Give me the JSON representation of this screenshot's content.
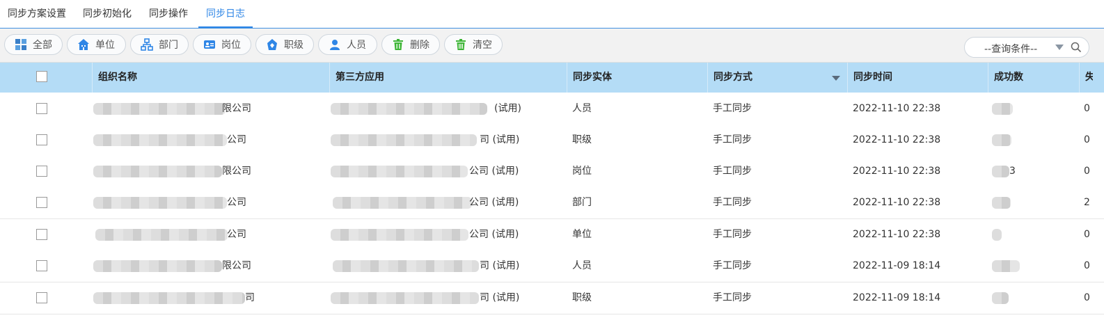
{
  "tabs": [
    {
      "label": "同步方案设置"
    },
    {
      "label": "同步初始化"
    },
    {
      "label": "同步操作"
    },
    {
      "label": "同步日志",
      "active": true
    }
  ],
  "toolbar": {
    "buttons": [
      {
        "label": "全部",
        "icon": "grid-all-icon"
      },
      {
        "label": "单位",
        "icon": "building-icon"
      },
      {
        "label": "部门",
        "icon": "org-chart-icon"
      },
      {
        "label": "岗位",
        "icon": "id-card-icon"
      },
      {
        "label": "职级",
        "icon": "rank-icon"
      },
      {
        "label": "人员",
        "icon": "user-icon"
      },
      {
        "label": "删除",
        "icon": "trash-icon"
      },
      {
        "label": "清空",
        "icon": "trash-clear-icon"
      }
    ],
    "query": {
      "label": "--查询条件--"
    }
  },
  "table": {
    "columns": [
      "组织名称",
      "第三方应用",
      "同步实体",
      "同步方式",
      "同步时间",
      "成功数",
      "失"
    ],
    "rows": [
      {
        "org_suffix": "限公司",
        "app_suffix": "(试用)",
        "entity": "人员",
        "method": "手工同步",
        "time": "2022-11-10 22:38",
        "success": "",
        "fail": "0"
      },
      {
        "org_suffix": "公司",
        "app_suffix": "司 (试用)",
        "entity": "职级",
        "method": "手工同步",
        "time": "2022-11-10 22:38",
        "success": "",
        "fail": "0"
      },
      {
        "org_suffix": "限公司",
        "app_suffix": "公司 (试用)",
        "entity": "岗位",
        "method": "手工同步",
        "time": "2022-11-10 22:38",
        "success": "3",
        "fail": "0"
      },
      {
        "org_suffix": "公司",
        "app_suffix": "公司 (试用)",
        "entity": "部门",
        "method": "手工同步",
        "time": "2022-11-10 22:38",
        "success": "",
        "fail": "2"
      },
      {
        "org_suffix": "公司",
        "app_suffix": "公司 (试用)",
        "entity": "单位",
        "method": "手工同步",
        "time": "2022-11-10 22:38",
        "success": "",
        "fail": "0"
      },
      {
        "org_suffix": "限公司",
        "app_suffix": "司 (试用)",
        "entity": "人员",
        "method": "手工同步",
        "time": "2022-11-09 18:14",
        "success": "",
        "fail": "0"
      },
      {
        "org_suffix": "司",
        "app_suffix": "司 (试用)",
        "entity": "职级",
        "method": "手工同步",
        "time": "2022-11-09 18:14",
        "success": "",
        "fail": "0"
      }
    ]
  },
  "colors": {
    "accent": "#2f86e6",
    "header_bg": "#b4dcf6",
    "toolbar_bg": "#f2f2f2"
  }
}
